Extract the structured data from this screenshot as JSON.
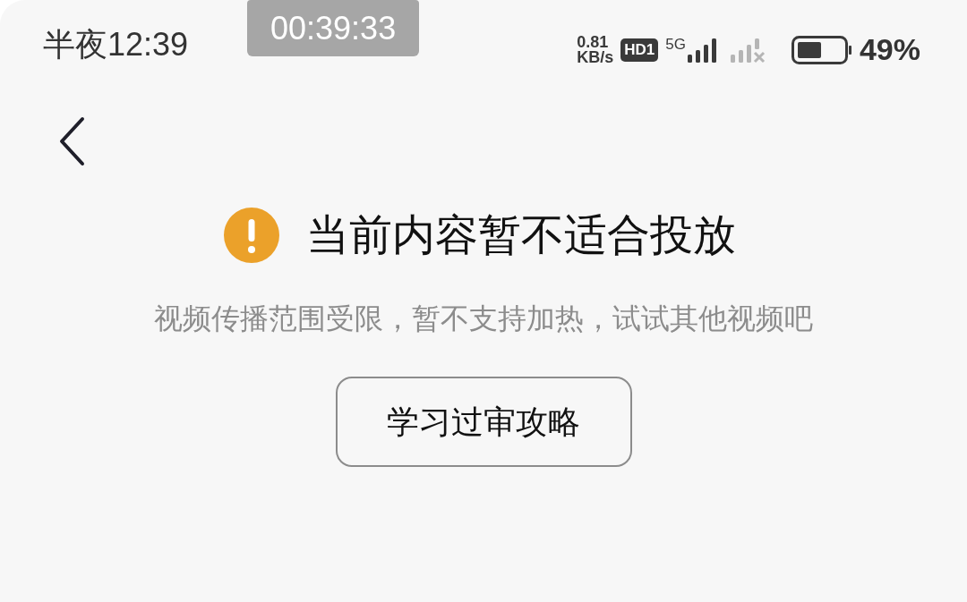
{
  "status_bar": {
    "time": "半夜12:39",
    "recording_timer": "00:39:33",
    "net_speed_value": "0.81",
    "net_speed_unit": "KB/s",
    "hd_badge": "HD1",
    "network_type": "5G",
    "battery_percent": "49%"
  },
  "notice": {
    "title": "当前内容暂不适合投放",
    "message": "视频传播范围受限，暂不支持加热，试试其他视频吧",
    "button": "学习过审攻略"
  }
}
